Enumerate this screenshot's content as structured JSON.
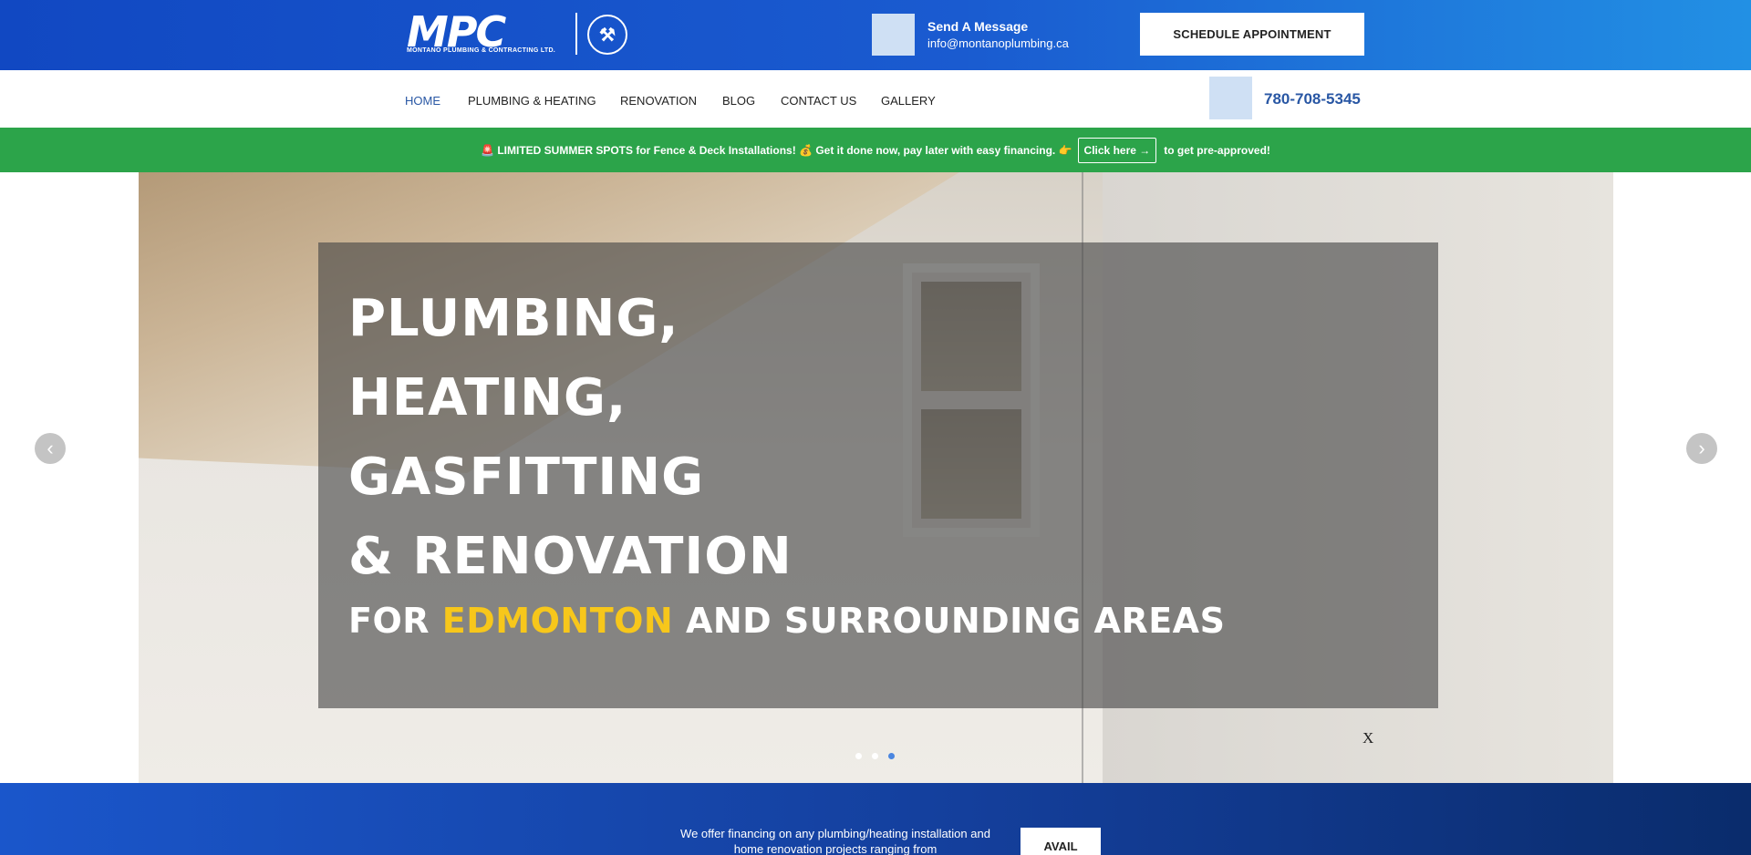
{
  "header": {
    "logo_text": "MPC",
    "logo_subtitle": "MONTANO PLUMBING & CONTRACTING LTD.",
    "message_label": "Send A Message",
    "email": "info@montanoplumbing.ca",
    "schedule_label": "SCHEDULE APPOINTMENT"
  },
  "nav": {
    "items": [
      {
        "label": "HOME",
        "active": true
      },
      {
        "label": "PLUMBING & HEATING",
        "active": false
      },
      {
        "label": "RENOVATION",
        "active": false
      },
      {
        "label": "BLOG",
        "active": false
      },
      {
        "label": "CONTACT US",
        "active": false
      },
      {
        "label": "GALLERY",
        "active": false
      }
    ],
    "phone": "780-708-5345"
  },
  "promo": {
    "text_before": "🚨 LIMITED SUMMER SPOTS for Fence & Deck Installations! 💰 Get it done now, pay later with easy financing. 👉",
    "button_label": "Click here →",
    "text_after": "to get pre-approved!"
  },
  "hero": {
    "lines": [
      "PLUMBING,",
      "HEATING,",
      "GASFITTING",
      "& RENOVATION"
    ],
    "sub_prefix": "FOR ",
    "sub_highlight": "EDMONTON",
    "sub_suffix": " AND SURROUNDING AREAS",
    "close_label": "X",
    "prev_arrow": "‹",
    "next_arrow": "›",
    "slide_count": 3,
    "active_slide": 3
  },
  "finance": {
    "text": "We offer financing on any plumbing/heating installation and home renovation projects ranging from",
    "button_label": "AVAIL"
  },
  "colors": {
    "brand_blue": "#1a5bd0",
    "accent_link": "#2957a4",
    "promo_green": "#2ca44a",
    "highlight_yellow": "#f7c71b"
  }
}
